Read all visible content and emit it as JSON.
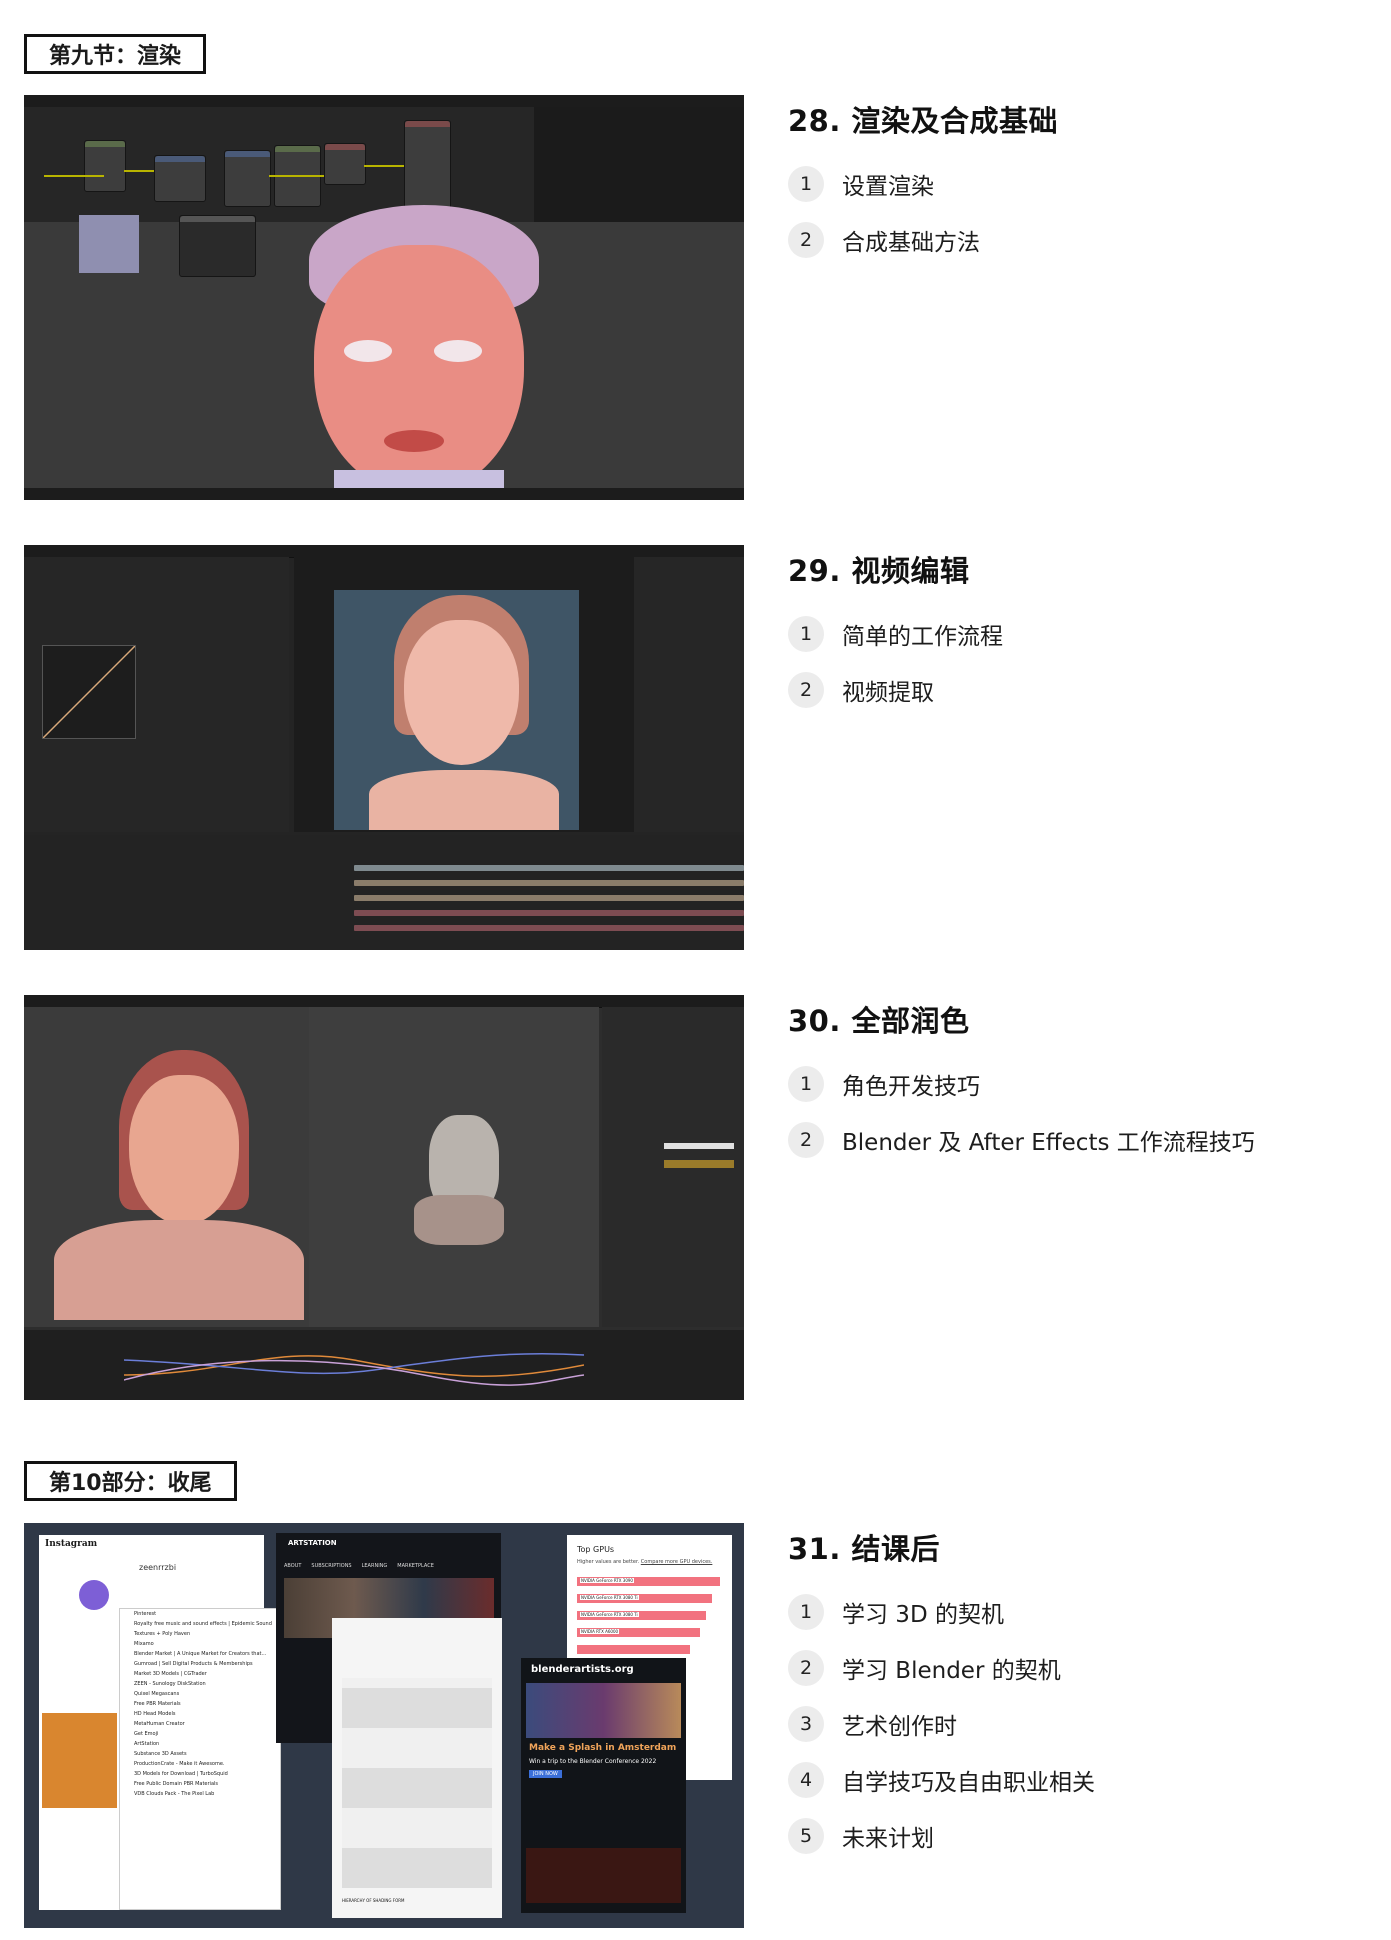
{
  "part1": {
    "tag": "第九节：渲染"
  },
  "part2": {
    "tag": "第10部分：收尾"
  },
  "lessons": [
    {
      "title": "28. 渲染及合成基础",
      "items": [
        {
          "num": "1",
          "text": "设置渲染"
        },
        {
          "num": "2",
          "text": "合成基础方法"
        }
      ]
    },
    {
      "title": "29. 视频编辑",
      "items": [
        {
          "num": "1",
          "text": "简单的工作流程"
        },
        {
          "num": "2",
          "text": "视频提取"
        }
      ]
    },
    {
      "title": "30. 全部润色",
      "items": [
        {
          "num": "1",
          "text": "角色开发技巧"
        },
        {
          "num": "2",
          "text": "Blender 及 After Effects 工作流程技巧"
        }
      ]
    },
    {
      "title": "31. 结课后",
      "items": [
        {
          "num": "1",
          "text": "学习 3D 的契机"
        },
        {
          "num": "2",
          "text": "学习 Blender 的契机"
        },
        {
          "num": "3",
          "text": "艺术创作时"
        },
        {
          "num": "4",
          "text": "自学技巧及自由职业相关"
        },
        {
          "num": "5",
          "text": "未来计划"
        }
      ]
    }
  ],
  "collage": {
    "artstation": "ARTSTATION",
    "artstation_nav": [
      "ABOUT",
      "SUBSCRIPTIONS",
      "LEARNING",
      "MARKETPLACE"
    ],
    "gpu_title": "Top GPUs",
    "gpu_sub": "Higher values are better.",
    "gpu_link": "Compare more GPU devices.",
    "gpus": [
      {
        "name": "NVIDIA GeForce RTX 3090",
        "score": 0.95
      },
      {
        "name": "NVIDIA GeForce RTX 3080 Ti",
        "score": 0.9
      },
      {
        "name": "NVIDIA GeForce RTX 3080 Ti",
        "score": 0.86
      },
      {
        "name": "NVIDIA RTX A6000",
        "score": 0.82
      },
      {
        "name": "",
        "score": 0.75
      },
      {
        "name": "",
        "score": 0.68
      },
      {
        "name": "",
        "score": 0.6
      }
    ],
    "blenderartists": "blenderartists.org",
    "splash": "Make a Splash in Amsterdam",
    "splash_sub": "Win a trip to the Blender Conference 2022",
    "join": "JOIN NOW",
    "instagram": "Instagram",
    "profile_name": "zeenrrzbi",
    "bookmarks": [
      "Pinterest",
      "Royalty free music and sound effects | Epidemic Sound",
      "Textures + Poly Haven",
      "Mixamo",
      "Blender Market | A Unique Market for Creators that...",
      "Gumroad | Sell Digital Products & Memberships",
      "Market 3D Models | CGTrader",
      "ZEEN - Sunology DiskStation",
      "Quixel Megascans",
      "Free PBR Materials",
      "HD Head Models",
      "MetaHuman Creator",
      "Get Emoji",
      "ArtStation",
      "Substance 3D Assets",
      "ProductionCrate - Make it Awesome.",
      "3D Models for Download | TurboSquid",
      "Free Public Domain PBR Materials",
      "VDB Clouds Pack - The Pixel Lab"
    ],
    "anatomy_caption": "HIERARCHY OF SHADING FORM"
  }
}
